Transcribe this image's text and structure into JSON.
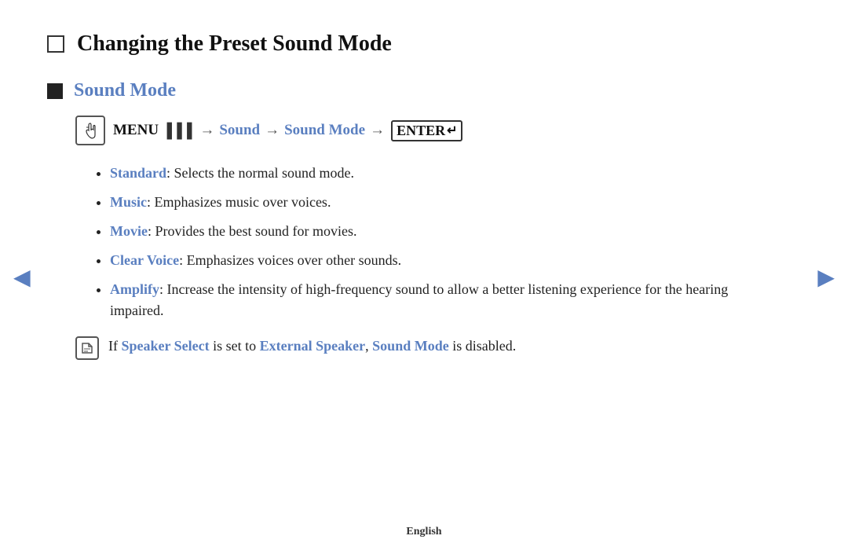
{
  "page": {
    "main_title": "Changing the Preset Sound Mode",
    "section_title": "Sound Mode",
    "menu_label": "MENU",
    "sound_label": "Sound",
    "sound_mode_label": "Sound Mode",
    "enter_label": "ENTER",
    "bullet_items": [
      {
        "term": "Standard",
        "description": ": Selects the normal sound mode."
      },
      {
        "term": "Music",
        "description": ": Emphasizes music over voices."
      },
      {
        "term": "Movie",
        "description": ": Provides the best sound for movies."
      },
      {
        "term": "Clear Voice",
        "description": ": Emphasizes voices over other sounds."
      },
      {
        "term": "Amplify",
        "description": ": Increase the intensity of high-frequency sound to allow a better listening experience for the hearing impaired."
      }
    ],
    "note_part1": " If ",
    "note_speaker_select": "Speaker Select",
    "note_part2": " is set to ",
    "note_external_speaker": "External Speaker",
    "note_part3": ", ",
    "note_sound_mode": "Sound Mode",
    "note_part4": " is disabled.",
    "footer": "English",
    "nav_left": "◄",
    "nav_right": "►"
  }
}
